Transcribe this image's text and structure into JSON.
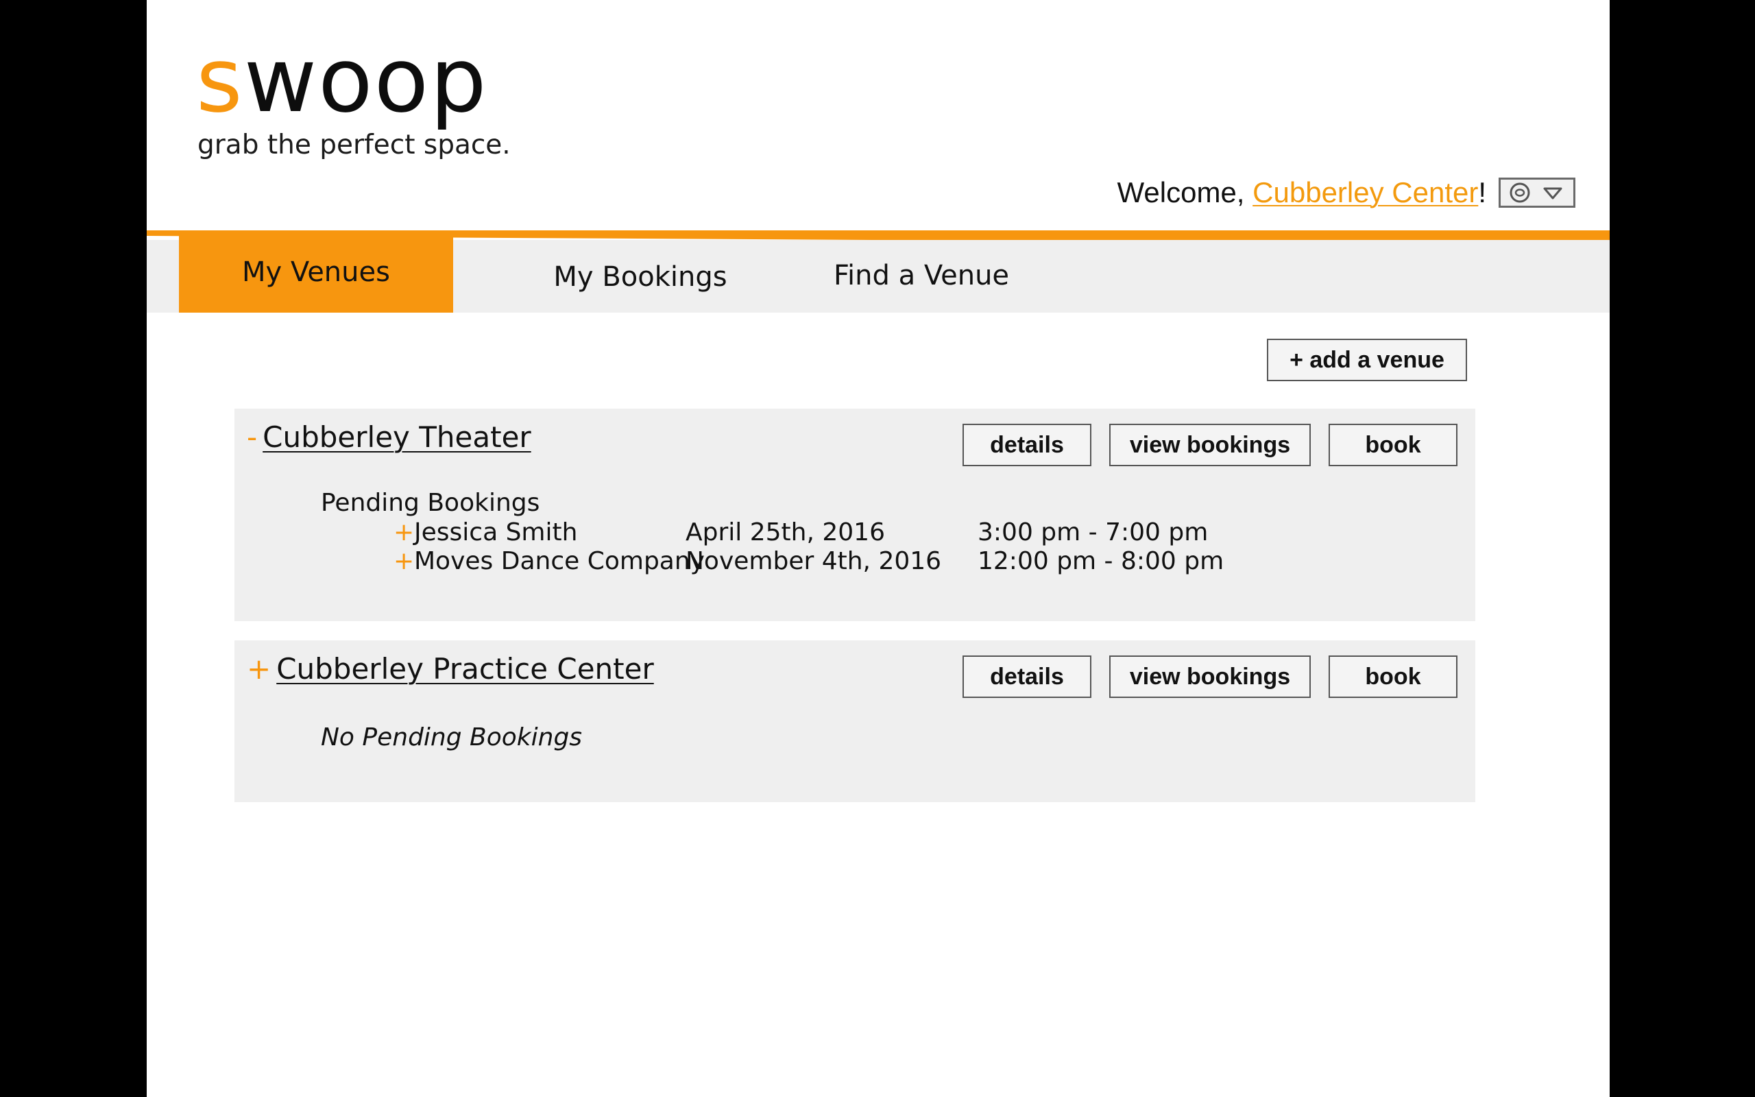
{
  "brand": {
    "logo_first_letter": "s",
    "logo_rest": "woop",
    "tagline": "grab the perfect space.",
    "accent_color": "#f7960f"
  },
  "header": {
    "welcome_prefix": "Welcome, ",
    "user_name": "Cubberley Center",
    "welcome_suffix": "!",
    "account_menu_icons": [
      "settings-circle-icon",
      "dropdown-triangle-icon"
    ]
  },
  "nav": {
    "tabs": [
      {
        "label": "My Venues",
        "active": true
      },
      {
        "label": "My Bookings",
        "active": false
      },
      {
        "label": "Find a Venue",
        "active": false
      }
    ]
  },
  "toolbar": {
    "add_venue_label": "+ add a venue"
  },
  "venues": [
    {
      "toggle": "-",
      "name": "Cubberley Theater",
      "buttons": {
        "details": "details",
        "view_bookings": "view bookings",
        "book": "book"
      },
      "pending_title": "Pending Bookings",
      "bookings": [
        {
          "expand": "+",
          "name": "Jessica Smith",
          "date": "April 25th, 2016",
          "time": "3:00 pm - 7:00 pm"
        },
        {
          "expand": "+",
          "name": "Moves Dance Company",
          "date": "November 4th, 2016",
          "time": "12:00 pm - 8:00 pm"
        }
      ]
    },
    {
      "toggle": "+",
      "name": "Cubberley Practice Center",
      "buttons": {
        "details": "details",
        "view_bookings": "view bookings",
        "book": "book"
      },
      "empty_message": "No Pending Bookings"
    }
  ]
}
